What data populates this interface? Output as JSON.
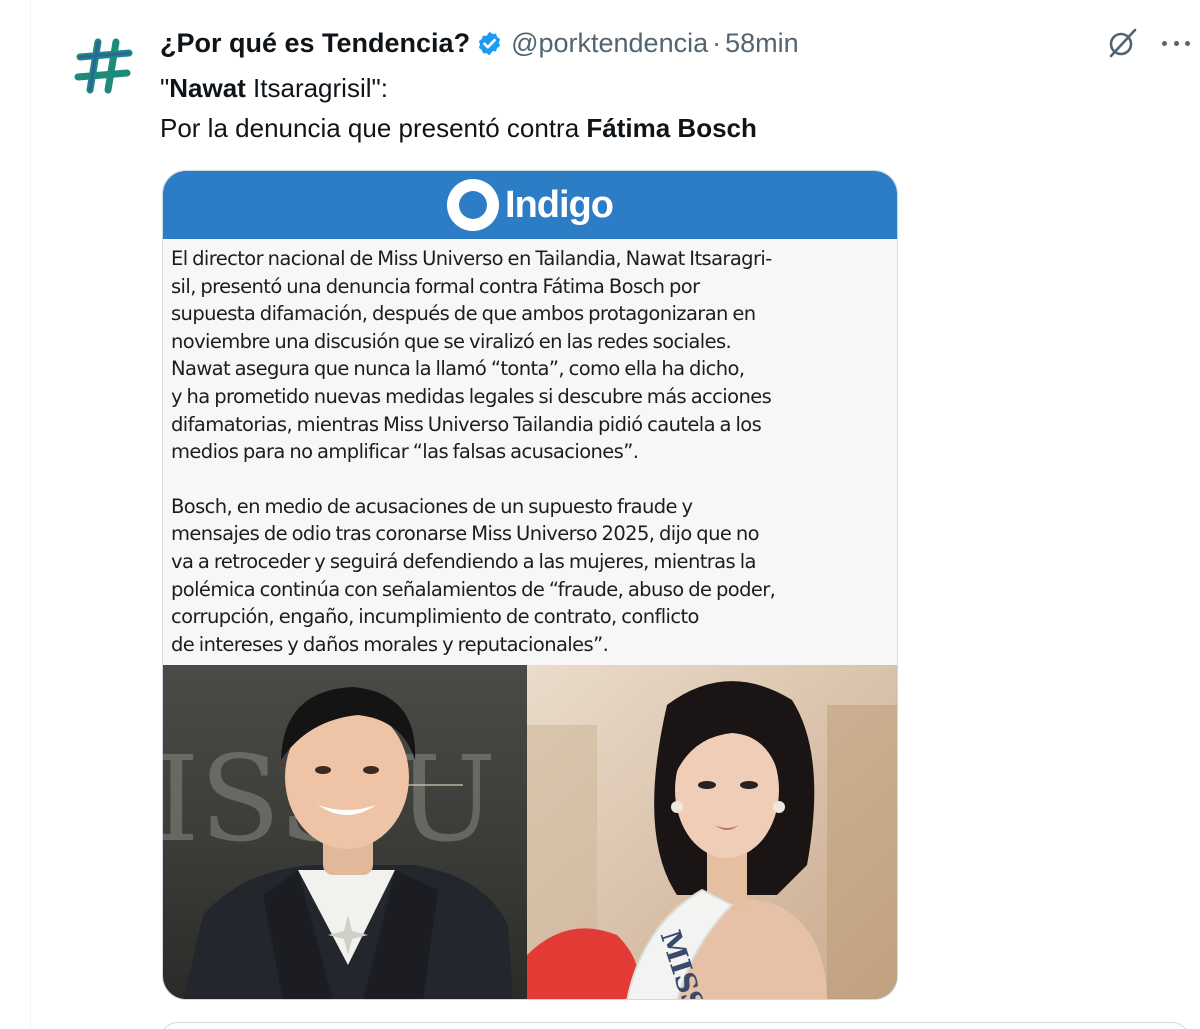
{
  "tweet": {
    "display_name": "¿Por qué es Tendencia?",
    "handle": "@porktendencia",
    "separator": "·",
    "time": "58min",
    "verified": true,
    "text_line1_quote_open": "\"",
    "text_line1_bold": "Nawat",
    "text_line1_rest": " Itsaragrisil\":",
    "text_line2_regular": "Por la denuncia que presentó contra ",
    "text_line2_bold": "Fátima Bosch"
  },
  "card": {
    "logo_text": "Indigo",
    "paragraph1": [
      "El director nacional de Miss Universo en Tailandia, Nawat Itsaragri-",
      "sil, presentó una denuncia formal contra Fátima Bosch por",
      "supuesta difamación, después de que ambos protagonizaran en",
      "noviembre una discusión que se viralizó en las redes sociales.",
      "Nawat asegura que nunca la llamó “tonta”, como ella ha dicho,",
      "y ha prometido nuevas medidas legales si descubre más acciones",
      "difamatorias, mientras Miss Universo Tailandia pidió cautela a los",
      "medios para no amplificar “las falsas acusaciones”."
    ],
    "paragraph2": [
      "Bosch, en medio de acusaciones de un supuesto fraude y",
      "mensajes de odio tras coronarse Miss Universo 2025, dijo que no",
      "va a retroceder y seguirá defendiendo a las mujeres, mientras la",
      "polémica continúa con señalamientos de “fraude, abuso de poder,",
      "corrupción, engaño, incumplimiento de contrato, conflicto",
      "de intereses y daños morales y reputacionales”."
    ],
    "photo_left_text": "ISS U",
    "photo_right_sash_text": "MISS"
  },
  "colors": {
    "brand_blue": "#2d7dc6",
    "verified_blue": "#1d9bf0",
    "avatar_green": "#1e8a7a",
    "secondary_text": "#536471"
  },
  "icons": {
    "avatar": "hashtag-icon",
    "verified": "verified-badge-icon",
    "grok": "grok-icon",
    "more": "more-horizontal-icon"
  }
}
